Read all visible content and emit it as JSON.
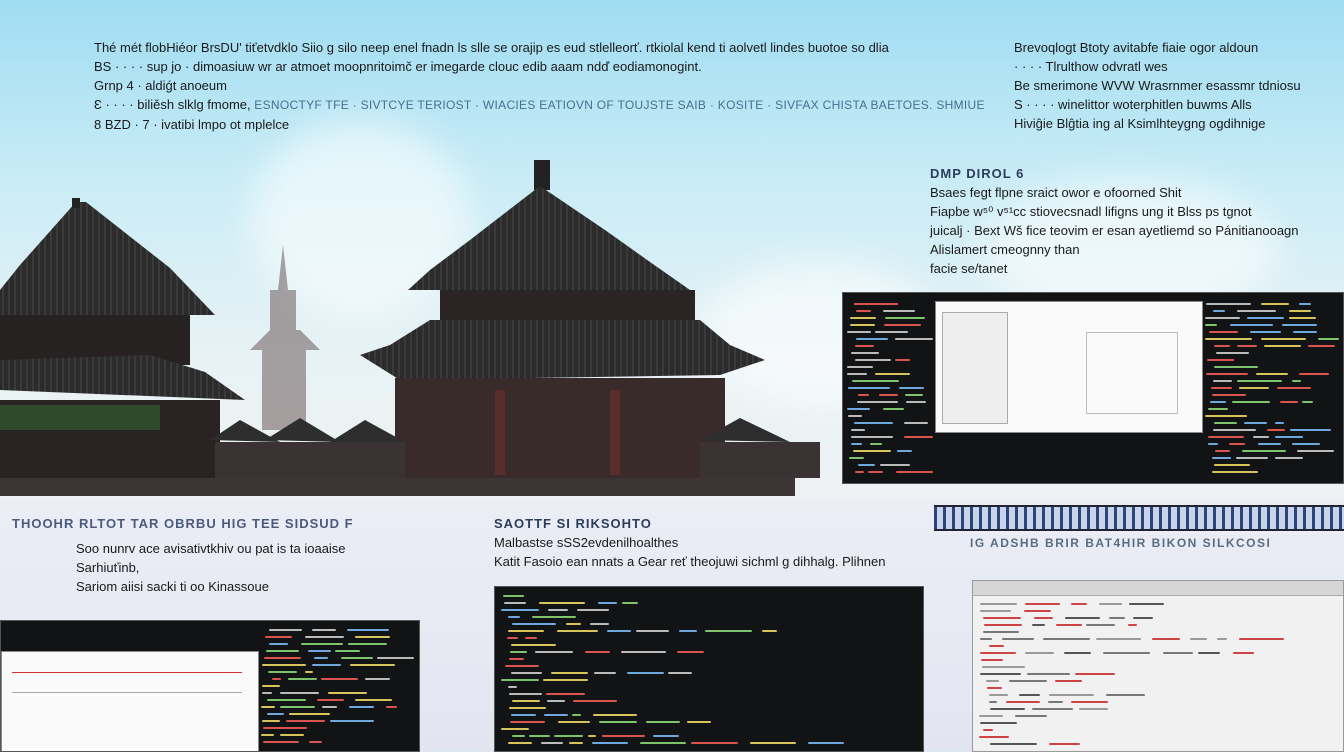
{
  "top_left_block": {
    "lines": [
      "Thé mét flobHiéor BrsDU' tiťetvdklo Siio g silo neep enel fnadn ls slle se orajip es eud stlelleorť. rtkiolal kend ti aolvetl lindes buotoe so dlia",
      "BS · · · · sup jo · dimoasiuw wr ar atmoet moopnritoimč er imegarde clouc edib aaam ndď eodiamonogint.",
      "Grnp 4 · aldiǵt anoeum",
      "Ɛ · · · · biliěsh slklg fmome,",
      "8 BZD · 7 · ivatibi lmpo ot mplelce"
    ],
    "tag_line": "ESNOCTYF TFE · SIVTCYE TERIOST · WIACIES EATIOVN OF TOUJSTE SAIB · KOSITE · SIVFAX CHISTA BAETOES. SHMIUE"
  },
  "top_right_block": {
    "lines": [
      "Brevoqlogt Btoty avitabfe fiaie ogor aldoun",
      "· · · · Tlrulthow odvratl wes",
      "Be smerimone WVW Wrasrnmer esassmr tdniosu",
      "S · · · · winelittor woterphitlen buwms Alls",
      "Hiviĝie Blĝtia ing al Ksimlhteygng ogdihnige"
    ]
  },
  "right_mid_block": {
    "heading": "DMP DIROL 6",
    "lines": [
      "Bsaes fegt flpne sraict owor e ofoorned Shit",
      "Fiapbe w⁵⁰ v⁵¹cc stiovecsnadl lifigns ung it Blss ps tgnot",
      "juicalj · Bext Wš fice teovim er esan ayetliemd so Pánitianooagn",
      "Alislamert cmeognny than",
      "facie se/tanet"
    ]
  },
  "bottom_left_block": {
    "heading": "THOOHR RLTOT TAR OBRBU HIG TEE SIDSUD F",
    "lines": [
      "Soo nunrv ace avisativtkhiv ou pat is ta ioaaise",
      "Sarhiuťinb,",
      "Sariom aiisi sacki ti oo Kinassoue"
    ]
  },
  "bottom_mid_block": {
    "heading": "SAOTTF SI RIKSOHTO",
    "lines": [
      "Malbastse sSS2evdenilhoalthes",
      "Katit Fasoio ean nnats a Gear reť theojuwi sichml g dihhalg. Plihnen"
    ]
  },
  "bottom_right_block": {
    "subhead": "IG ADSHB BRIR BAT4HIR BIKON SILKCOSI"
  },
  "colors": {
    "sky_top": "#9fdcf2",
    "roof": "#2b2b2b",
    "wall": "#3a3030",
    "code_green": "#7ec26b",
    "code_red": "#d9534f",
    "code_yellow": "#d6c35a",
    "code_blue": "#6fa8dc"
  }
}
